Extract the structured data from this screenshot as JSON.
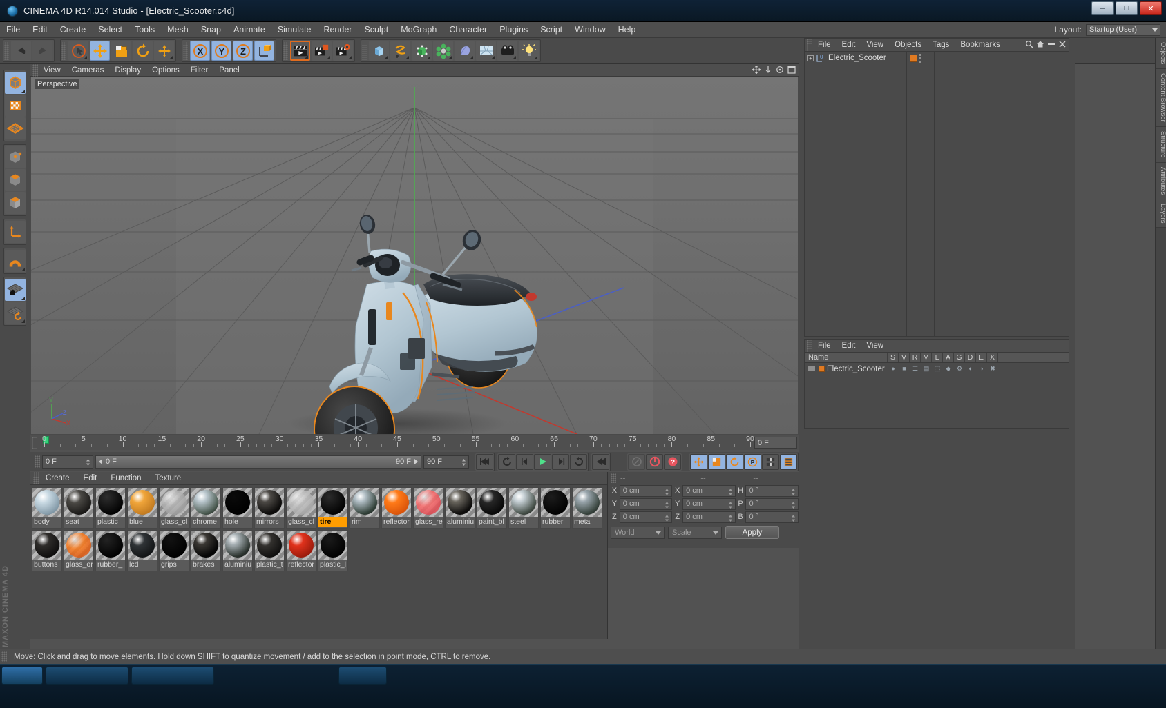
{
  "window": {
    "title": "CINEMA 4D R14.014 Studio - [Electric_Scooter.c4d]",
    "app_icon": "cinema4d-icon",
    "minimize": "–",
    "maximize": "□",
    "close": "✕"
  },
  "menubar": {
    "items": [
      "File",
      "Edit",
      "Create",
      "Select",
      "Tools",
      "Mesh",
      "Snap",
      "Animate",
      "Simulate",
      "Render",
      "Sculpt",
      "MoGraph",
      "Character",
      "Plugins",
      "Script",
      "Window",
      "Help"
    ],
    "layout_label": "Layout:",
    "layout_value": "Startup (User)"
  },
  "toolbar": {
    "groups": [
      {
        "name": "undo-redo",
        "buttons": [
          {
            "name": "undo-button",
            "icon": "undo-icon",
            "state": "normal"
          },
          {
            "name": "redo-button",
            "icon": "redo-icon",
            "state": "disabled"
          }
        ]
      },
      {
        "name": "transform-tools",
        "buttons": [
          {
            "name": "live-selection-tool",
            "icon": "cursor-select-icon",
            "state": "normal"
          },
          {
            "name": "move-tool",
            "icon": "move-icon",
            "state": "active"
          },
          {
            "name": "scale-tool",
            "icon": "scale-icon",
            "state": "normal"
          },
          {
            "name": "rotate-tool",
            "icon": "rotate-icon",
            "state": "normal"
          },
          {
            "name": "magnet-tool",
            "icon": "plus-move-icon",
            "state": "normal"
          }
        ]
      },
      {
        "name": "axis-locks",
        "buttons": [
          {
            "name": "lock-x-axis-button",
            "icon": "x-axis-icon",
            "state": "active"
          },
          {
            "name": "lock-y-axis-button",
            "icon": "y-axis-icon",
            "state": "active"
          },
          {
            "name": "lock-z-axis-button",
            "icon": "z-axis-icon",
            "state": "active"
          },
          {
            "name": "world-object-coordinates-button",
            "icon": "world-axis-icon",
            "state": "normal"
          }
        ]
      },
      {
        "name": "render-tools",
        "buttons": [
          {
            "name": "render-view-button",
            "icon": "render-clapper-icon",
            "state": "selected"
          },
          {
            "name": "render-region-button",
            "icon": "render-region-icon",
            "state": "normal"
          },
          {
            "name": "render-settings-button",
            "icon": "render-settings-icon",
            "state": "normal"
          }
        ]
      },
      {
        "name": "creation-tools",
        "buttons": [
          {
            "name": "add-cube-button",
            "icon": "cube-icon",
            "state": "normal"
          },
          {
            "name": "add-spline-button",
            "icon": "spline-icon",
            "state": "normal"
          },
          {
            "name": "add-nurbs-button",
            "icon": "nurbs-icon",
            "state": "normal"
          },
          {
            "name": "add-array-button",
            "icon": "array-icon",
            "state": "normal"
          },
          {
            "name": "add-deformer-button",
            "icon": "deformer-icon",
            "state": "normal"
          },
          {
            "name": "add-environment-button",
            "icon": "environment-icon",
            "state": "normal"
          },
          {
            "name": "add-camera-button",
            "icon": "camera-icon",
            "state": "normal"
          },
          {
            "name": "add-light-button",
            "icon": "light-bulb-icon",
            "state": "normal"
          }
        ]
      }
    ]
  },
  "left_palette": {
    "groups": [
      {
        "name": "mode-group-1",
        "buttons": [
          {
            "name": "model-mode-button",
            "icon": "model-cube-icon",
            "state": "active"
          },
          {
            "name": "texture-mode-button",
            "icon": "checker-texture-icon",
            "state": "normal"
          },
          {
            "name": "polygon-grid-mode-button",
            "icon": "grid-plane-icon",
            "state": "normal"
          }
        ]
      },
      {
        "name": "component-group",
        "buttons": [
          {
            "name": "points-mode-button",
            "icon": "points-cube-icon",
            "state": "normal"
          },
          {
            "name": "edges-mode-button",
            "icon": "edges-cube-icon",
            "state": "normal"
          },
          {
            "name": "polygons-mode-button",
            "icon": "polygons-cube-icon",
            "state": "normal"
          }
        ]
      },
      {
        "name": "axis-group",
        "buttons": [
          {
            "name": "enable-axis-modification-button",
            "icon": "axis-l-icon",
            "state": "normal"
          }
        ]
      },
      {
        "name": "snap-group",
        "buttons": [
          {
            "name": "enable-snapping-button",
            "icon": "magnet-icon",
            "state": "normal"
          }
        ]
      },
      {
        "name": "workplane-group",
        "buttons": [
          {
            "name": "lock-workplane-button",
            "icon": "workplane-lock-icon",
            "state": "active"
          },
          {
            "name": "workplane-align-button",
            "icon": "workplane-rotate-icon",
            "state": "normal"
          }
        ]
      }
    ]
  },
  "viewport": {
    "menu_items": [
      "View",
      "Cameras",
      "Display",
      "Options",
      "Filter",
      "Panel"
    ],
    "label": "Perspective",
    "axis_labels": {
      "x": "X",
      "y": "Y",
      "z": "Z"
    },
    "corner_icons": [
      "pan-icon",
      "zoom-icon",
      "rotate-view-icon",
      "maximize-view-icon"
    ],
    "scene_object": "Electric_Scooter",
    "colors": {
      "grid_bg_top": "#707070",
      "grid_bg_bottom": "#6a6a6a",
      "grid_line": "#5c5c5c",
      "x_axis": "#c2392e",
      "y_axis": "#4caf50",
      "z_axis": "#3f51b5",
      "body_blue": "#b7cbd6",
      "accent_orange": "#e8871e",
      "seat_dark": "#303438",
      "tire_black": "#1e1e1e"
    }
  },
  "timeline": {
    "ticks": [
      0,
      5,
      10,
      15,
      20,
      25,
      30,
      35,
      40,
      45,
      50,
      55,
      60,
      65,
      70,
      75,
      80,
      85,
      90
    ],
    "current_frame_field": "0 F",
    "playhead_frame": 0
  },
  "transport": {
    "start_frame": "0 F",
    "slider_left": "0 F",
    "slider_right": "90 F",
    "end_frame": "90 F",
    "buttons": [
      {
        "name": "go-to-start-button",
        "icon": "skip-start-icon"
      },
      {
        "name": "previous-key-button",
        "icon": "loop-back-icon"
      },
      {
        "name": "step-back-button",
        "icon": "step-back-icon"
      },
      {
        "name": "play-button",
        "icon": "play-icon"
      },
      {
        "name": "step-forward-button",
        "icon": "step-forward-icon"
      },
      {
        "name": "next-key-button",
        "icon": "loop-forward-icon"
      },
      {
        "name": "go-to-end-button",
        "icon": "skip-end-icon"
      },
      {
        "name": "record-options-button",
        "icon": "keyframe-icon"
      },
      {
        "name": "autokeying-button",
        "icon": "autokey-icon"
      },
      {
        "name": "record-active-objects-button",
        "icon": "record-icon"
      },
      {
        "name": "keyframe-position-button",
        "icon": "position-key-icon"
      },
      {
        "name": "keyframe-scale-button",
        "icon": "scale-key-icon"
      },
      {
        "name": "keyframe-rotation-button",
        "icon": "rotation-key-icon"
      },
      {
        "name": "keyframe-param-button",
        "icon": "param-key-icon"
      },
      {
        "name": "keyframe-pla-button",
        "icon": "pla-key-icon"
      },
      {
        "name": "level-of-detail-button",
        "icon": "lod-icon"
      }
    ]
  },
  "material_manager": {
    "menu_items": [
      "Create",
      "Edit",
      "Function",
      "Texture"
    ],
    "selected": "tire",
    "materials": [
      {
        "name": "body",
        "color1": "#c7d8e2",
        "color2": "#6f8796",
        "type": "glossy"
      },
      {
        "name": "seat",
        "color1": "#4a4844",
        "color2": "#0c0b0a",
        "type": "glossy"
      },
      {
        "name": "plastic",
        "color1": "#2e2e2e",
        "color2": "#000000",
        "type": "matte"
      },
      {
        "name": "blue",
        "color1": "#f0a53a",
        "color2": "#b6701a",
        "type": "glossy"
      },
      {
        "name": "glass_cl",
        "color1": "#b6b6b6",
        "color2": "#8e8e8e",
        "type": "transparent"
      },
      {
        "name": "chrome",
        "color1": "#b9c6cd",
        "color2": "#4a5a50",
        "type": "mirror"
      },
      {
        "name": "hole",
        "color1": "#0a0a0a",
        "color2": "#000000",
        "type": "matte"
      },
      {
        "name": "mirrors",
        "color1": "#4d4a46",
        "color2": "#0d0c0b",
        "type": "mirror"
      },
      {
        "name": "glass_cl",
        "color1": "#c2c2c2",
        "color2": "#9a9a9a",
        "type": "transparent"
      },
      {
        "name": "tire",
        "color1": "#2b2b2b",
        "color2": "#000000",
        "type": "matte"
      },
      {
        "name": "rim",
        "color1": "#b0bdc4",
        "color2": "#33423a",
        "type": "mirror"
      },
      {
        "name": "reflector",
        "color1": "#ff7a18",
        "color2": "#d04a06",
        "type": "glossy"
      },
      {
        "name": "glass_re",
        "color1": "#ff6b6b",
        "color2": "#d22b3a",
        "type": "transparent"
      },
      {
        "name": "aluminiu",
        "color1": "#6a665e",
        "color2": "#0f0e0d",
        "type": "mirror"
      },
      {
        "name": "paint_bl",
        "color1": "#262626",
        "color2": "#000000",
        "type": "glossy"
      },
      {
        "name": "steel",
        "color1": "#c3cdd2",
        "color2": "#454f48",
        "type": "mirror"
      },
      {
        "name": "rubber",
        "color1": "#1c1c1c",
        "color2": "#000000",
        "type": "matte"
      },
      {
        "name": "metal",
        "color1": "#9aa6ad",
        "color2": "#3a4640",
        "type": "mirror"
      },
      {
        "name": "buttons",
        "color1": "#2e2c2a",
        "color2": "#060606",
        "type": "glossy"
      },
      {
        "name": "glass_or",
        "color1": "#ff7a18",
        "color2": "#cf3f04",
        "type": "transparent"
      },
      {
        "name": "rubber_",
        "color1": "#232323",
        "color2": "#000000",
        "type": "matte"
      },
      {
        "name": "lcd",
        "color1": "#2f3336",
        "color2": "#0b0d0e",
        "type": "glossy"
      },
      {
        "name": "grips",
        "color1": "#121212",
        "color2": "#000000",
        "type": "matte"
      },
      {
        "name": "brakes",
        "color1": "#3a3733",
        "color2": "#060606",
        "type": "mirror"
      },
      {
        "name": "aluminiu",
        "color1": "#a7b0b4",
        "color2": "#2d3530",
        "type": "mirror"
      },
      {
        "name": "plastic_t",
        "color1": "#33312e",
        "color2": "#070707",
        "type": "glossy"
      },
      {
        "name": "reflector",
        "color1": "#e0321c",
        "color2": "#8a1508",
        "type": "glossy"
      },
      {
        "name": "plastic_l",
        "color1": "#1a1a1a",
        "color2": "#000000",
        "type": "matte"
      }
    ]
  },
  "coordinates": {
    "header_cols": [
      "--",
      "--",
      "--"
    ],
    "rows": [
      {
        "label1": "X",
        "value1": "0 cm",
        "label2": "X",
        "value2": "0 cm",
        "label3": "H",
        "value3": "0 °"
      },
      {
        "label1": "Y",
        "value1": "0 cm",
        "label2": "Y",
        "value2": "0 cm",
        "label3": "P",
        "value3": "0 °"
      },
      {
        "label1": "Z",
        "value1": "0 cm",
        "label2": "Z",
        "value2": "0 cm",
        "label3": "B",
        "value3": "0 °"
      }
    ],
    "coord_system": "World",
    "size_mode": "Scale",
    "apply_label": "Apply"
  },
  "object_manager": {
    "menu_items": [
      "File",
      "Edit",
      "View",
      "Objects",
      "Tags",
      "Bookmarks"
    ],
    "header_icons": [
      "search-icon",
      "home-icon",
      "minimize-panel-icon",
      "close-panel-icon"
    ],
    "objects": [
      {
        "name": "Electric_Scooter",
        "expandable": true,
        "layer": "0",
        "tag_color": "#e07a22"
      }
    ]
  },
  "attribute_manager": {
    "menu_items": [
      "File",
      "Edit",
      "View"
    ],
    "columns": [
      "Name",
      "S",
      "V",
      "R",
      "M",
      "L",
      "A",
      "G",
      "D",
      "E",
      "X"
    ],
    "rows": [
      {
        "name": "Electric_Scooter"
      }
    ]
  },
  "right_tabs": [
    "Objects",
    "Content Browser",
    "Structure",
    "Attributes",
    "Layers"
  ],
  "statusbar": {
    "message": "Move: Click and drag to move elements. Hold down SHIFT to quantize movement / add to the selection in point mode, CTRL to remove."
  },
  "watermark": {
    "line1": "MAXON",
    "line2": "CINEMA 4D"
  }
}
